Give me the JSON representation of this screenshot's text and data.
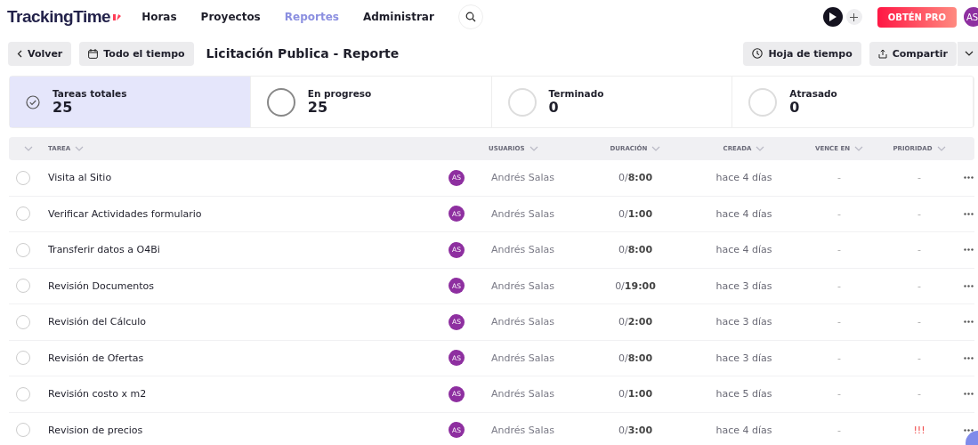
{
  "brand": {
    "name": "TrackingTime"
  },
  "nav": [
    {
      "label": "Horas",
      "selected": false
    },
    {
      "label": "Proyectos",
      "selected": false
    },
    {
      "label": "Reportes",
      "selected": true
    },
    {
      "label": "Administrar",
      "selected": false
    }
  ],
  "pro_button": "OBTÉN PRO",
  "avatar": "AS",
  "toolbar": {
    "back": "Volver",
    "range": "Todo el tiempo",
    "title": "Licitación Publica - Reporte",
    "timesheet": "Hoja de tiempo",
    "share": "Compartir"
  },
  "stats": [
    {
      "label": "Tareas totales",
      "value": "25",
      "selected": true
    },
    {
      "label": "En progreso",
      "value": "25",
      "selected": false
    },
    {
      "label": "Terminado",
      "value": "0",
      "selected": false
    },
    {
      "label": "Atrasado",
      "value": "0",
      "selected": false
    }
  ],
  "table": {
    "columns": [
      "TAREA",
      "USUARIOS",
      "DURACIÓN",
      "CREADA",
      "VENCE EN",
      "PRIORIDAD"
    ],
    "rows": [
      {
        "task": "Visita al Sitio",
        "initials": "AS",
        "user": "Andrés Salas",
        "duration": "0/**8:00**",
        "created": "hace 4 días",
        "due": "-",
        "priority": "-",
        "urgent": false,
        "checked": false
      },
      {
        "task": "Verificar Actividades formulario",
        "initials": "AS",
        "user": "Andrés Salas",
        "duration": "0/**1:00**",
        "created": "hace 4 días",
        "due": "-",
        "priority": "-",
        "urgent": false,
        "checked": false
      },
      {
        "task": "Transferir datos a O4Bi",
        "initials": "AS",
        "user": "Andrés Salas",
        "duration": "0/**8:00**",
        "created": "hace 4 días",
        "due": "-",
        "priority": "-",
        "urgent": false,
        "checked": false
      },
      {
        "task": "Revisión Documentos",
        "initials": "AS",
        "user": "Andrés Salas",
        "duration": "0/**19:00**",
        "created": "hace 3 días",
        "due": "-",
        "priority": "-",
        "urgent": false,
        "checked": false
      },
      {
        "task": "Revisión del Cálculo",
        "initials": "AS",
        "user": "Andrés Salas",
        "duration": "0/**2:00**",
        "created": "hace 3 días",
        "due": "-",
        "priority": "-",
        "urgent": false,
        "checked": false
      },
      {
        "task": "Revisión de Ofertas",
        "initials": "AS",
        "user": "Andrés Salas",
        "duration": "0/**8:00**",
        "created": "hace 3 días",
        "due": "-",
        "priority": "-",
        "urgent": false,
        "checked": false
      },
      {
        "task": "Revisión costo x m2",
        "initials": "AS",
        "user": "Andrés Salas",
        "duration": "0/**1:00**",
        "created": "hace 5 días",
        "due": "-",
        "priority": "-",
        "urgent": false,
        "checked": false
      },
      {
        "task": "Revision de precios",
        "initials": "AS",
        "user": "Andrés Salas",
        "duration": "0/**3:00**",
        "created": "hace 4 días",
        "due": "-",
        "priority": "!!!",
        "urgent": true,
        "checked": false
      }
    ]
  }
}
